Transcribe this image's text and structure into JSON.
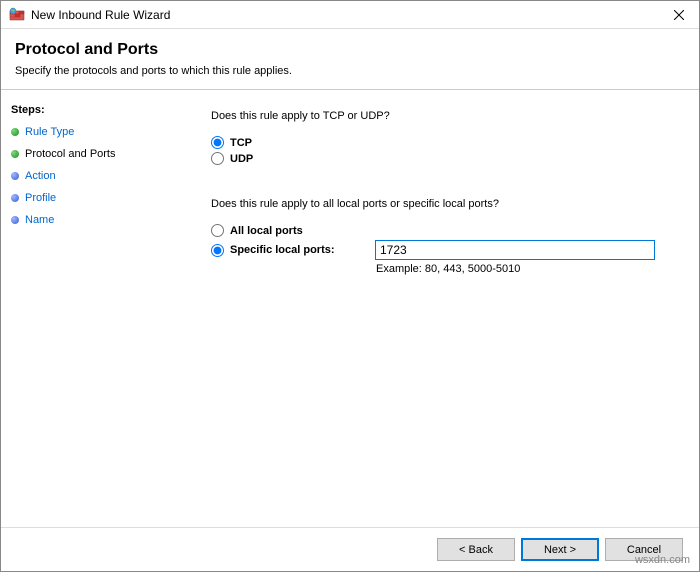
{
  "window": {
    "title": "New Inbound Rule Wizard"
  },
  "header": {
    "title": "Protocol and Ports",
    "subtitle": "Specify the protocols and ports to which this rule applies."
  },
  "sidebar": {
    "heading": "Steps:",
    "items": [
      {
        "label": "Rule Type",
        "state": "done"
      },
      {
        "label": "Protocol and Ports",
        "state": "current"
      },
      {
        "label": "Action",
        "state": "pending"
      },
      {
        "label": "Profile",
        "state": "pending"
      },
      {
        "label": "Name",
        "state": "pending"
      }
    ]
  },
  "main": {
    "question1": "Does this rule apply to TCP or UDP?",
    "tcp_label": "TCP",
    "udp_label": "UDP",
    "protocol_selected": "tcp",
    "question2": "Does this rule apply to all local ports or specific local ports?",
    "all_ports_label": "All local ports",
    "specific_ports_label": "Specific local ports:",
    "ports_selected": "specific",
    "port_value": "1723",
    "example_text": "Example: 80, 443, 5000-5010"
  },
  "footer": {
    "back": "< Back",
    "next": "Next >",
    "cancel": "Cancel"
  },
  "watermark": "wsxdn.com"
}
